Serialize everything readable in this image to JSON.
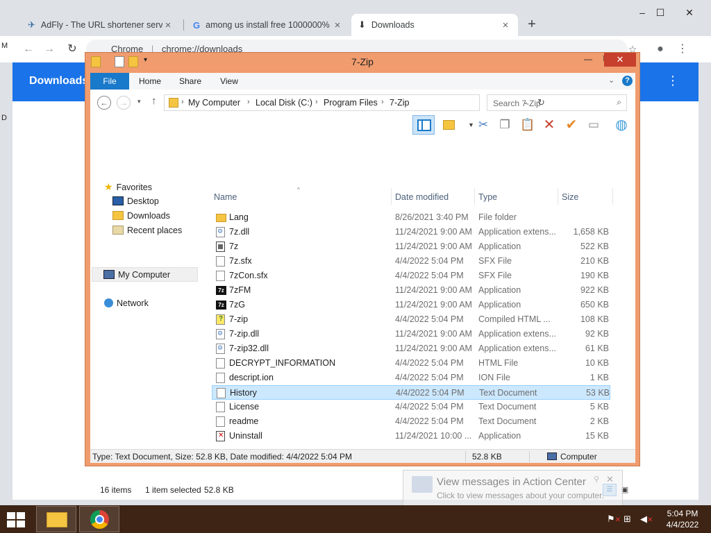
{
  "chrome": {
    "tabs": [
      {
        "label": "AdFly - The URL shortener servic",
        "icon": "adfly-icon"
      },
      {
        "label": "among us install free 1000000%",
        "icon": "google-icon"
      },
      {
        "label": "Downloads",
        "icon": "download-icon"
      }
    ],
    "omnibox": {
      "site": "Chrome",
      "url": "chrome://downloads"
    },
    "page_title": "Downloads",
    "edge_letters": [
      "M",
      "D"
    ]
  },
  "explorer": {
    "title": "7-Zip",
    "ribbon_tabs": [
      "File",
      "Home",
      "Share",
      "View"
    ],
    "breadcrumb": [
      "My Computer",
      "Local Disk (C:)",
      "Program Files",
      "7-Zip"
    ],
    "search_placeholder": "Search 7-Zip",
    "nav": {
      "favorites": "Favorites",
      "favorites_items": [
        "Desktop",
        "Downloads",
        "Recent places"
      ],
      "computer": "My Computer",
      "network": "Network"
    },
    "columns": {
      "name": "Name",
      "date": "Date modified",
      "type": "Type",
      "size": "Size"
    },
    "files": [
      {
        "name": "Lang",
        "date": "8/26/2021 3:40 PM",
        "type": "File folder",
        "size": "",
        "icon": "folder"
      },
      {
        "name": "7z.dll",
        "date": "11/24/2021 9:00 AM",
        "type": "Application extens...",
        "size": "1,658 KB",
        "icon": "dll"
      },
      {
        "name": "7z",
        "date": "11/24/2021 9:00 AM",
        "type": "Application",
        "size": "522 KB",
        "icon": "app"
      },
      {
        "name": "7z.sfx",
        "date": "4/4/2022 5:04 PM",
        "type": "SFX File",
        "size": "210 KB",
        "icon": "doc"
      },
      {
        "name": "7zCon.sfx",
        "date": "4/4/2022 5:04 PM",
        "type": "SFX File",
        "size": "190 KB",
        "icon": "doc"
      },
      {
        "name": "7zFM",
        "date": "11/24/2021 9:00 AM",
        "type": "Application",
        "size": "922 KB",
        "icon": "7z"
      },
      {
        "name": "7zG",
        "date": "11/24/2021 9:00 AM",
        "type": "Application",
        "size": "650 KB",
        "icon": "7z"
      },
      {
        "name": "7-zip",
        "date": "4/4/2022 5:04 PM",
        "type": "Compiled HTML ...",
        "size": "108 KB",
        "icon": "help"
      },
      {
        "name": "7-zip.dll",
        "date": "11/24/2021 9:00 AM",
        "type": "Application extens...",
        "size": "92 KB",
        "icon": "dll"
      },
      {
        "name": "7-zip32.dll",
        "date": "11/24/2021 9:00 AM",
        "type": "Application extens...",
        "size": "61 KB",
        "icon": "dll"
      },
      {
        "name": "DECRYPT_INFORMATION",
        "date": "4/4/2022 5:04 PM",
        "type": "HTML File",
        "size": "10 KB",
        "icon": "doc"
      },
      {
        "name": "descript.ion",
        "date": "4/4/2022 5:04 PM",
        "type": "ION File",
        "size": "1 KB",
        "icon": "doc"
      },
      {
        "name": "History",
        "date": "4/4/2022 5:04 PM",
        "type": "Text Document",
        "size": "53 KB",
        "icon": "doc",
        "selected": true
      },
      {
        "name": "License",
        "date": "4/4/2022 5:04 PM",
        "type": "Text Document",
        "size": "5 KB",
        "icon": "doc"
      },
      {
        "name": "readme",
        "date": "4/4/2022 5:04 PM",
        "type": "Text Document",
        "size": "2 KB",
        "icon": "doc"
      },
      {
        "name": "Uninstall",
        "date": "11/24/2021 10:00 ...",
        "type": "Application",
        "size": "15 KB",
        "icon": "uninstall"
      }
    ],
    "status": {
      "items": "16 items",
      "selected": "1 item selected",
      "selected_size": "52.8 KB",
      "info": "Type: Text Document, Size: 52.8 KB, Date modified: 4/4/2022 5:04 PM",
      "size": "52.8 KB",
      "location": "Computer"
    }
  },
  "action_center": {
    "title": "View messages in Action Center",
    "subtitle": "Click to view messages about your computer."
  },
  "taskbar": {
    "time": "5:04 PM",
    "date": "4/4/2022"
  },
  "colors": {
    "window_frame": "#f09c6e",
    "close_button": "#c7402d",
    "accent_blue": "#1979ca",
    "chrome_header": "#1a73e8",
    "taskbar": "#3d2414"
  }
}
